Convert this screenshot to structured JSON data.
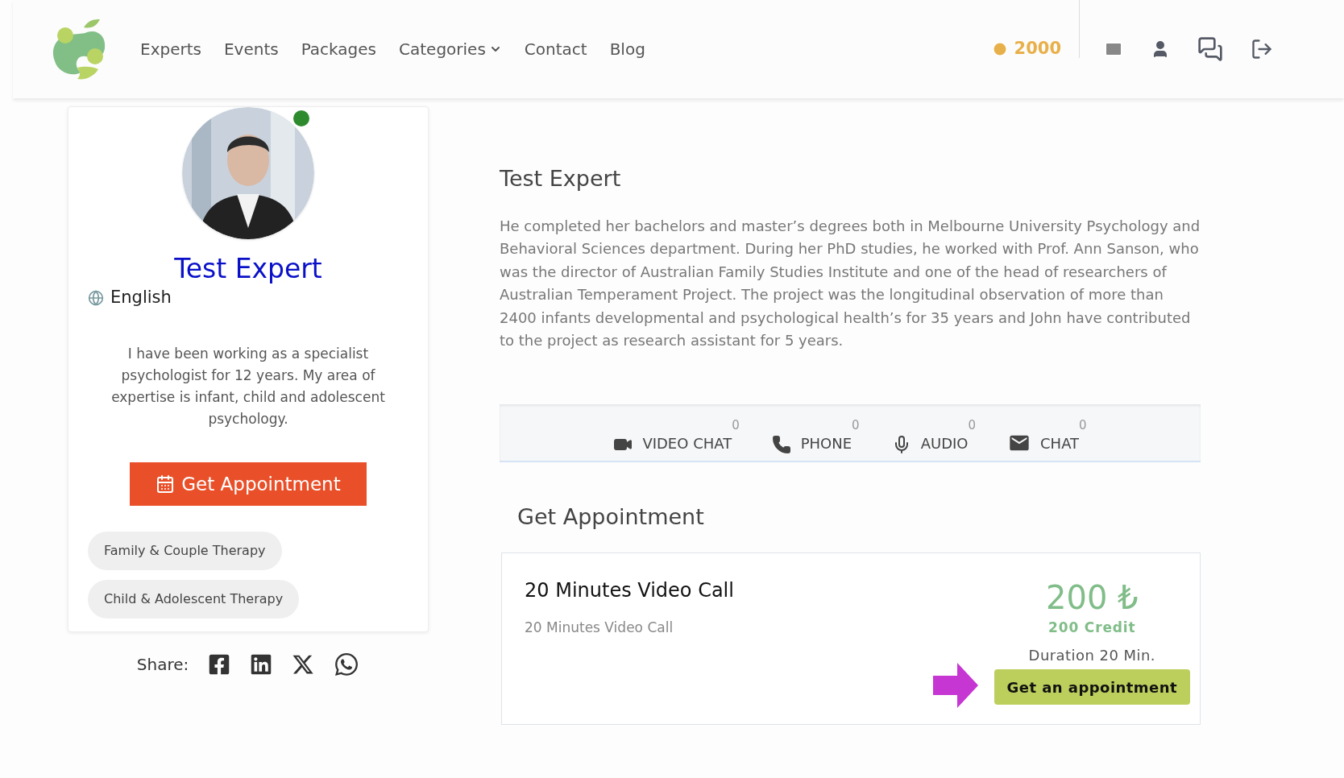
{
  "nav": {
    "items": [
      {
        "label": "Experts",
        "kind": "link"
      },
      {
        "label": "Events",
        "kind": "link"
      },
      {
        "label": "Packages",
        "kind": "link"
      },
      {
        "label": "Categories",
        "kind": "dropdown"
      },
      {
        "label": "Contact",
        "kind": "link"
      },
      {
        "label": "Blog",
        "kind": "link"
      }
    ],
    "credits": "2000"
  },
  "profile": {
    "online": true,
    "name": "Test Expert",
    "language": "English",
    "summary": "I have been working as a specialist psychologist for 12 years. My area of expertise is infant, child and adolescent psychology.",
    "button": "Get Appointment",
    "tags": [
      "Family & Couple Therapy",
      "Child & Adolescent Therapy"
    ],
    "share_label": "Share:"
  },
  "about": {
    "title": "Test Expert",
    "text": "He completed her bachelors and master’s degrees both in Melbourne University Psychology and Behavioral Sciences department. During her PhD studies, he worked with Prof. Ann Sanson, who was the director of Australian Family Studies Institute and one of the head of researchers of Australian Temperament Project. The project was the longitudinal observation of more than 2400 infants developmental and psychological health’s for 35 years and John have contributed to the project as research assistant for 5 years."
  },
  "channels": [
    {
      "kind": "video",
      "label": "VIDEO CHAT",
      "count": "0"
    },
    {
      "kind": "phone",
      "label": "PHONE",
      "count": "0"
    },
    {
      "kind": "audio",
      "label": "AUDIO",
      "count": "0"
    },
    {
      "kind": "chat",
      "label": "CHAT",
      "count": "0"
    }
  ],
  "appointment": {
    "heading": "Get Appointment",
    "title": "20 Minutes Video Call",
    "subtitle": "20 Minutes Video Call",
    "price": "200 ₺",
    "credit": "200 Credit",
    "duration": "Duration 20 Min.",
    "button": "Get an appointment"
  }
}
